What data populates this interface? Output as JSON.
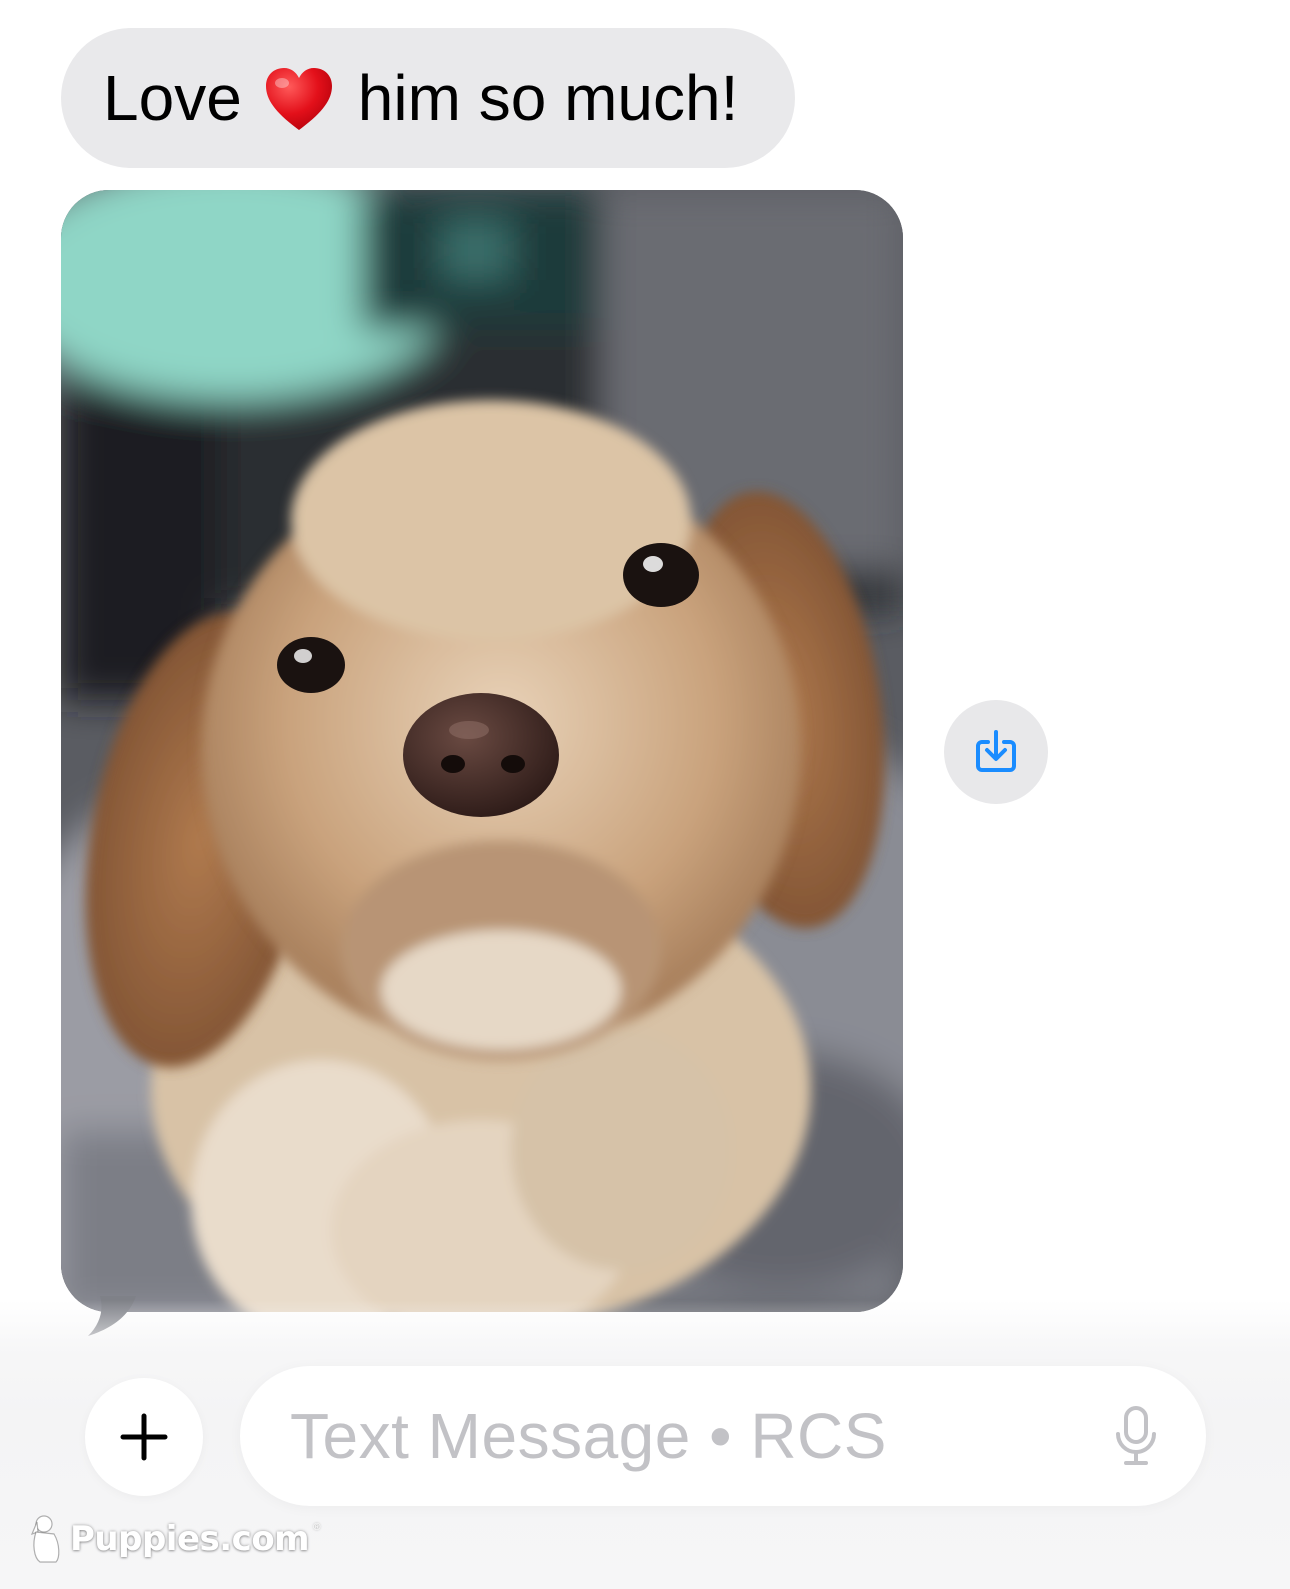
{
  "conversation": {
    "messages": [
      {
        "type": "text",
        "direction": "received",
        "text_before_emoji": "Love",
        "emoji": "red-heart",
        "text_after_emoji": "him so much!"
      },
      {
        "type": "image",
        "direction": "received",
        "subject": "fluffy puppy photo"
      }
    ],
    "save_button_icon": "download-to-tray-icon"
  },
  "composer": {
    "add_button_icon": "plus-icon",
    "placeholder": "Text Message • RCS",
    "mic_icon": "microphone-icon"
  },
  "watermark": {
    "brand": "Puppies.com",
    "registered_mark": "®"
  },
  "colors": {
    "received_bubble": "#e9e9eb",
    "accent_blue": "#1a8cff",
    "placeholder_gray": "#c2c2c6"
  }
}
